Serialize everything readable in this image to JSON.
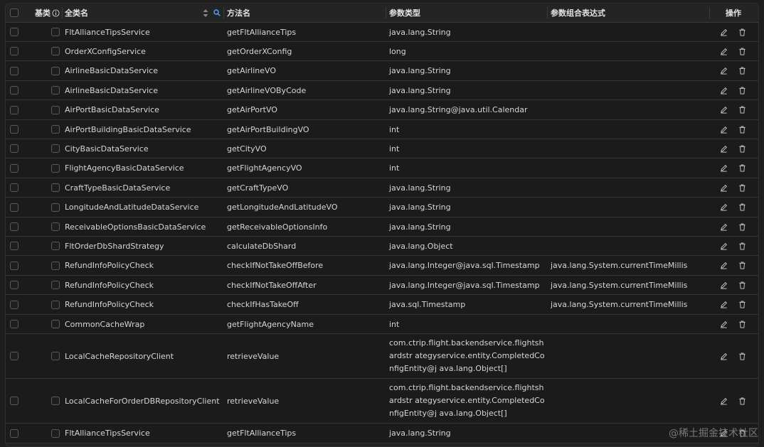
{
  "header": {
    "col_base": "基类",
    "col_class": "全类名",
    "col_method": "方法名",
    "col_param_type": "参数类型",
    "col_param_expr": "参数组合表达式",
    "col_action": "操作"
  },
  "rows": [
    {
      "cls": "FltAllianceTipsService",
      "method": "getFltAllianceTips",
      "ptype": "java.lang.String",
      "expr": ""
    },
    {
      "cls": "OrderXConfigService",
      "method": "getOrderXConfig",
      "ptype": "long",
      "expr": ""
    },
    {
      "cls": "AirlineBasicDataService",
      "method": "getAirlineVO",
      "ptype": "java.lang.String",
      "expr": ""
    },
    {
      "cls": "AirlineBasicDataService",
      "method": "getAirlineVOByCode",
      "ptype": "java.lang.String",
      "expr": ""
    },
    {
      "cls": "AirPortBasicDataService",
      "method": "getAirPortVO",
      "ptype": "java.lang.String@java.util.Calendar",
      "expr": ""
    },
    {
      "cls": "AirPortBuildingBasicDataService",
      "method": "getAirPortBuildingVO",
      "ptype": "int",
      "expr": ""
    },
    {
      "cls": "CityBasicDataService",
      "method": "getCityVO",
      "ptype": "int",
      "expr": ""
    },
    {
      "cls": "FlightAgencyBasicDataService",
      "method": "getFlightAgencyVO",
      "ptype": "int",
      "expr": ""
    },
    {
      "cls": "CraftTypeBasicDataService",
      "method": "getCraftTypeVO",
      "ptype": "java.lang.String",
      "expr": ""
    },
    {
      "cls": "LongitudeAndLatitudeDataService",
      "method": "getLongitudeAndLatitudeVO",
      "ptype": "java.lang.String",
      "expr": ""
    },
    {
      "cls": "ReceivableOptionsBasicDataService",
      "method": "getReceivableOptionsInfo",
      "ptype": "java.lang.String",
      "expr": ""
    },
    {
      "cls": "FltOrderDbShardStrategy",
      "method": "calculateDbShard",
      "ptype": "java.lang.Object",
      "expr": ""
    },
    {
      "cls": "RefundInfoPolicyCheck",
      "method": "checkIfNotTakeOffBefore",
      "ptype": "java.lang.Integer@java.sql.Timestamp",
      "expr": "java.lang.System.currentTimeMillis"
    },
    {
      "cls": "RefundInfoPolicyCheck",
      "method": "checkIfNotTakeOffAfter",
      "ptype": "java.lang.Integer@java.sql.Timestamp",
      "expr": "java.lang.System.currentTimeMillis"
    },
    {
      "cls": "RefundInfoPolicyCheck",
      "method": "checkIfHasTakeOff",
      "ptype": "java.sql.Timestamp",
      "expr": "java.lang.System.currentTimeMillis"
    },
    {
      "cls": "CommonCacheWrap",
      "method": "getFlightAgencyName",
      "ptype": "int",
      "expr": ""
    },
    {
      "cls": "LocalCacheRepositoryClient",
      "method": "retrieveValue",
      "ptype": "com.ctrip.flight.backendservice.flightshardstr ategyservice.entity.CompletedConfigEntity@j ava.lang.Object[]",
      "expr": ""
    },
    {
      "cls": "LocalCacheForOrderDBRepositoryClient",
      "method": "retrieveValue",
      "ptype": "com.ctrip.flight.backendservice.flightshardstr ategyservice.entity.CompletedConfigEntity@j ava.lang.Object[]",
      "expr": ""
    },
    {
      "cls": "FltAllianceTipsService",
      "method": "getFltAllianceTips",
      "ptype": "java.lang.String",
      "expr": ""
    }
  ],
  "watermark": "@稀土掘金技术社区",
  "colors": {
    "background": "#1e1e1e",
    "row": "#1b1b1b",
    "border": "#343434",
    "text": "#d6d6d6",
    "accent": "#5aa0ff"
  },
  "icons": {
    "edit": "pencil-icon",
    "delete": "trash-icon",
    "info": "info-icon",
    "sort": "sort-icon",
    "search": "search-icon"
  }
}
